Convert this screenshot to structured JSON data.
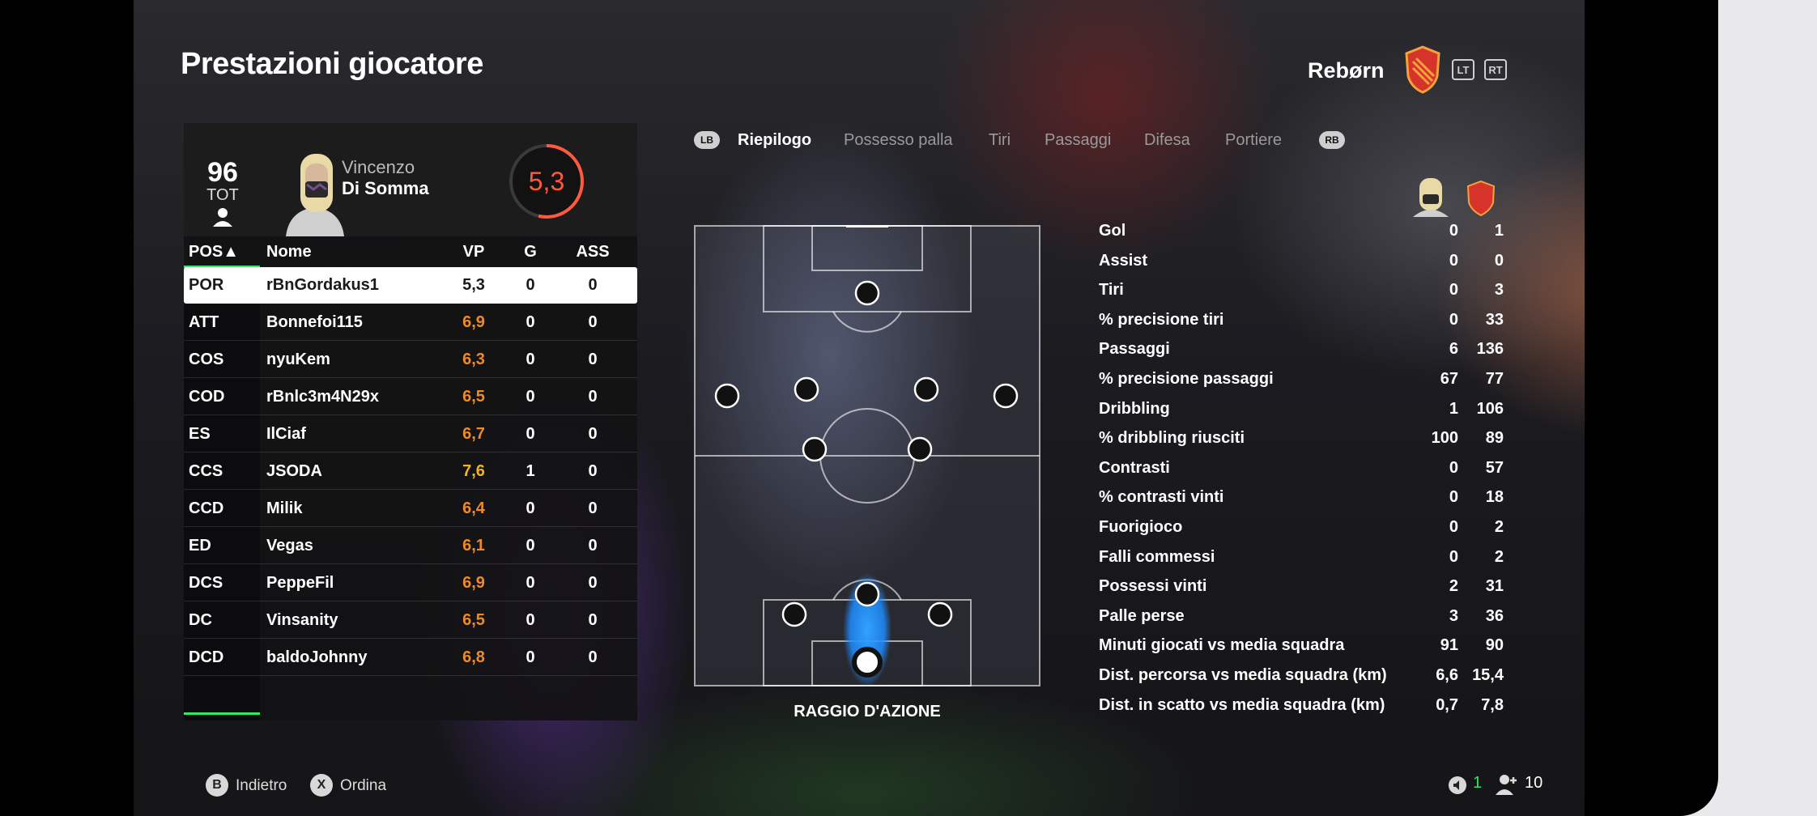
{
  "page_title": "Prestazioni giocatore",
  "team": {
    "name": "Rebørn",
    "crest_icon": "shield-icon"
  },
  "triggers": [
    "LT",
    "RT"
  ],
  "player": {
    "overall": "96",
    "overall_label": "TOT",
    "first_name": "Vincenzo",
    "last_name": "Di Somma",
    "rating": "5,3",
    "rating_color": "#ff5a3c"
  },
  "roster": {
    "headers": {
      "pos": "POS▲",
      "name": "Nome",
      "vp": "VP",
      "g": "G",
      "ass": "ASS"
    },
    "rows": [
      {
        "pos": "POR",
        "name": "rBnGordakus1",
        "vp": "5,3",
        "g": "0",
        "ass": "0",
        "vp_color": "#1a1a1a"
      },
      {
        "pos": "ATT",
        "name": "Bonnefoi115",
        "vp": "6,9",
        "g": "0",
        "ass": "0",
        "vp_color": "#f08a24"
      },
      {
        "pos": "COS",
        "name": "nyuKem",
        "vp": "6,3",
        "g": "0",
        "ass": "0",
        "vp_color": "#f08a24"
      },
      {
        "pos": "COD",
        "name": "rBnlc3m4N29x",
        "vp": "6,5",
        "g": "0",
        "ass": "0",
        "vp_color": "#f08a24"
      },
      {
        "pos": "ES",
        "name": "IlCiaf",
        "vp": "6,7",
        "g": "0",
        "ass": "0",
        "vp_color": "#f08a24"
      },
      {
        "pos": "CCS",
        "name": "JSODA",
        "vp": "7,6",
        "g": "1",
        "ass": "0",
        "vp_color": "#f2b51e"
      },
      {
        "pos": "CCD",
        "name": "Milik",
        "vp": "6,4",
        "g": "0",
        "ass": "0",
        "vp_color": "#f08a24"
      },
      {
        "pos": "ED",
        "name": "Vegas",
        "vp": "6,1",
        "g": "0",
        "ass": "0",
        "vp_color": "#f08a24"
      },
      {
        "pos": "DCS",
        "name": "PeppeFil",
        "vp": "6,9",
        "g": "0",
        "ass": "0",
        "vp_color": "#f08a24"
      },
      {
        "pos": "DC",
        "name": "Vinsanity",
        "vp": "6,5",
        "g": "0",
        "ass": "0",
        "vp_color": "#f08a24"
      },
      {
        "pos": "DCD",
        "name": "baldoJohnny",
        "vp": "6,8",
        "g": "0",
        "ass": "0",
        "vp_color": "#f08a24"
      }
    ]
  },
  "tabs": {
    "left_button": "LB",
    "right_button": "RB",
    "items": [
      "Riepilogo",
      "Possesso palla",
      "Tiri",
      "Passaggi",
      "Difesa",
      "Portiere"
    ],
    "active": "Riepilogo"
  },
  "pitch": {
    "caption": "RAGGIO D'AZIONE"
  },
  "stats": [
    {
      "label": "Gol",
      "player": "0",
      "team": "1"
    },
    {
      "label": "Assist",
      "player": "0",
      "team": "0"
    },
    {
      "label": "Tiri",
      "player": "0",
      "team": "3"
    },
    {
      "label": "% precisione tiri",
      "player": "0",
      "team": "33"
    },
    {
      "label": "Passaggi",
      "player": "6",
      "team": "136"
    },
    {
      "label": "% precisione passaggi",
      "player": "67",
      "team": "77"
    },
    {
      "label": "Dribbling",
      "player": "1",
      "team": "106"
    },
    {
      "label": "% dribbling riusciti",
      "player": "100",
      "team": "89"
    },
    {
      "label": "Contrasti",
      "player": "0",
      "team": "57"
    },
    {
      "label": "% contrasti vinti",
      "player": "0",
      "team": "18"
    },
    {
      "label": "Fuorigioco",
      "player": "0",
      "team": "2"
    },
    {
      "label": "Falli commessi",
      "player": "0",
      "team": "2"
    },
    {
      "label": "Possessi vinti",
      "player": "2",
      "team": "31"
    },
    {
      "label": "Palle perse",
      "player": "3",
      "team": "36"
    },
    {
      "label": "Minuti giocati vs media squadra",
      "player": "91",
      "team": "90"
    },
    {
      "label": "Dist. percorsa vs media squadra (km)",
      "player": "6,6",
      "team": "15,4"
    },
    {
      "label": "Dist. in scatto vs media squadra (km)",
      "player": "0,7",
      "team": "7,8"
    }
  ],
  "footer": {
    "back_button": "B",
    "back_label": "Indietro",
    "sort_button": "X",
    "sort_label": "Ordina",
    "audio_count": "1",
    "party_count": "10",
    "audio_color": "#2ee86a"
  }
}
